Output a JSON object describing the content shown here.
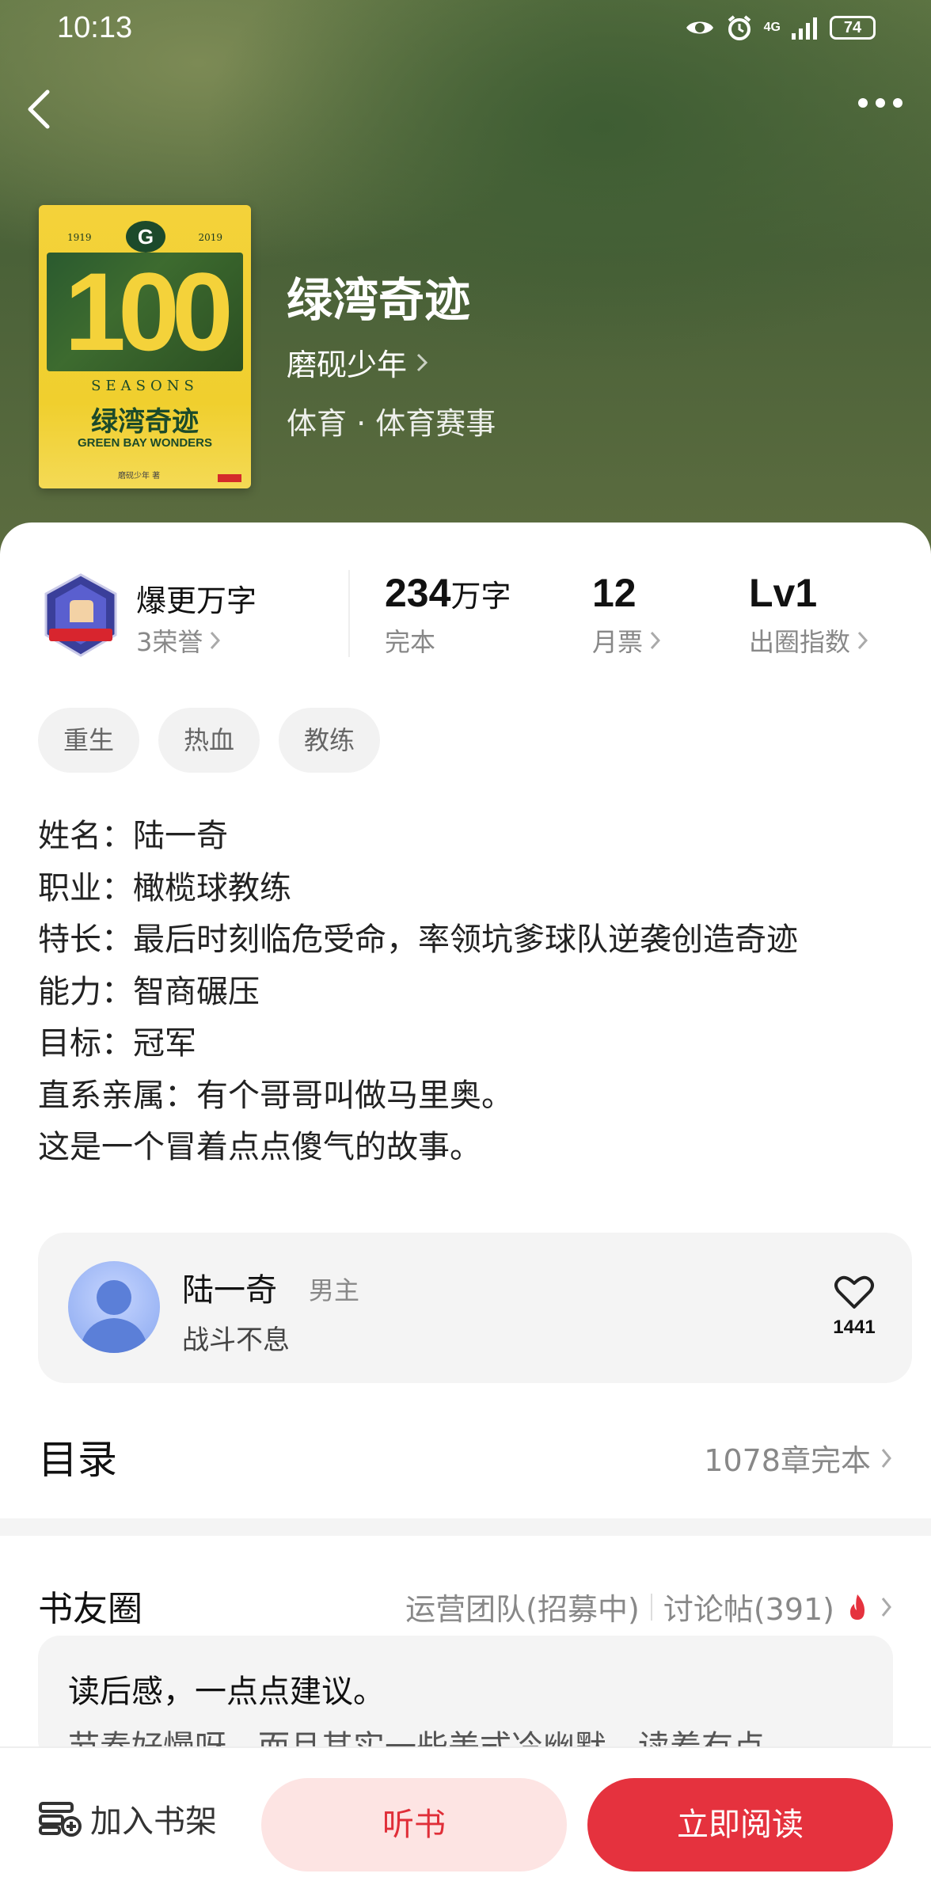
{
  "status_bar": {
    "time": "10:13",
    "network": "4G",
    "battery": "74"
  },
  "book": {
    "title": "绿湾奇迹",
    "author": "磨砚少年",
    "genre": "体育 · 体育赛事",
    "cover": {
      "years_left": "1919",
      "years_right": "2019",
      "logo": "G",
      "big_number": "100",
      "seasons": "SEASONS",
      "title": "绿湾奇迹",
      "subtitle": "GREEN BAY WONDERS",
      "author": "磨砚少年 著"
    }
  },
  "honor": {
    "title": "爆更万字",
    "sub": "3荣誉"
  },
  "stats": [
    {
      "value": "234",
      "unit": "万字",
      "label": "完本"
    },
    {
      "value": "12",
      "unit": "",
      "label": "月票"
    },
    {
      "value": "Lv1",
      "unit": "",
      "label": "出圈指数"
    }
  ],
  "tags": [
    "重生",
    "热血",
    "教练"
  ],
  "synopsis": [
    "姓名：陆一奇",
    "职业：橄榄球教练",
    "特长：最后时刻临危受命，率领坑爹球队逆袭创造奇迹",
    "能力：智商碾压",
    "目标：冠军",
    "直系亲属：有个哥哥叫做马里奥。",
    "这是一个冒着点点傻气的故事。"
  ],
  "character": {
    "name": "陆一奇",
    "role": "男主",
    "desc": "战斗不息",
    "likes": "1441"
  },
  "toc": {
    "title": "目录",
    "count": "1078章完本"
  },
  "circle": {
    "title": "书友圈",
    "team": "运营团队(招募中)",
    "posts": "讨论帖(391)",
    "post_title": "读后感，一点点建议。",
    "post_body": "节奏好慢呀，而且其实一些美式冷幽默，读着有点"
  },
  "bottom": {
    "shelf": "加入书架",
    "listen": "听书",
    "read": "立即阅读"
  },
  "colors": {
    "accent": "#e5323e",
    "listen_bg": "#fde4e3",
    "hero": "#4a6138"
  }
}
